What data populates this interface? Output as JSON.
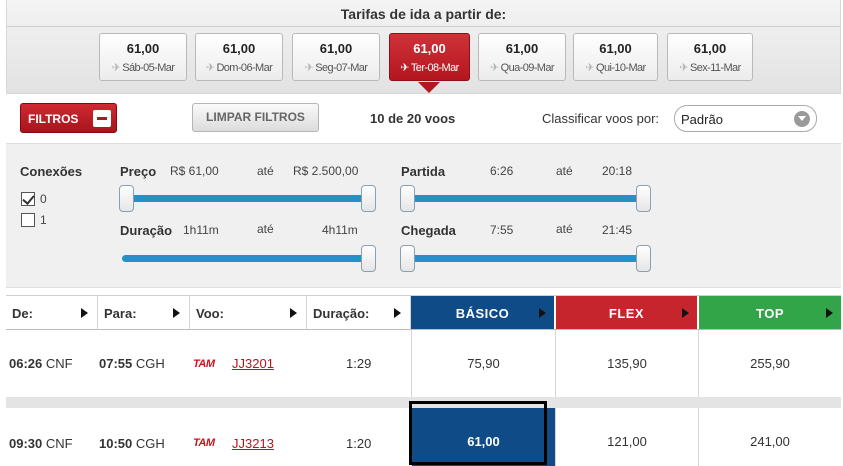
{
  "date_strip": {
    "title": "Tarifas de ida a partir de:",
    "tabs": [
      {
        "price": "61,00",
        "label": "Sáb-05-Mar",
        "selected": false
      },
      {
        "price": "61,00",
        "label": "Dom-06-Mar",
        "selected": false
      },
      {
        "price": "61,00",
        "label": "Seg-07-Mar",
        "selected": false
      },
      {
        "price": "61,00",
        "label": "Ter-08-Mar",
        "selected": true
      },
      {
        "price": "61,00",
        "label": "Qua-09-Mar",
        "selected": false
      },
      {
        "price": "61,00",
        "label": "Qui-10-Mar",
        "selected": false
      },
      {
        "price": "61,00",
        "label": "Sex-11-Mar",
        "selected": false
      }
    ]
  },
  "toolbar": {
    "filtros_label": "FILTROS",
    "limpar_label": "LIMPAR FILTROS",
    "count": "10 de 20 voos",
    "sort_label": "Classificar voos por:",
    "sort_value": "Padrão"
  },
  "filters": {
    "conexoes": {
      "label": "Conexões",
      "options": [
        {
          "label": "0",
          "checked": true
        },
        {
          "label": "1",
          "checked": false
        }
      ]
    },
    "preco": {
      "label": "Preço",
      "min": "R$ 61,00",
      "sep": "até",
      "max": "R$ 2.500,00"
    },
    "duracao": {
      "label": "Duração",
      "min": "1h11m",
      "sep": "até",
      "max": "4h11m"
    },
    "partida": {
      "label": "Partida",
      "min": "6:26",
      "sep": "até",
      "max": "20:18"
    },
    "chegada": {
      "label": "Chegada",
      "min": "7:55",
      "sep": "até",
      "max": "21:45"
    }
  },
  "table": {
    "headers": {
      "de": "De:",
      "para": "Para:",
      "voo": "Voo:",
      "duracao": "Duração:",
      "basico": "BÁSICO",
      "flex": "FLEX",
      "top": "TOP"
    },
    "airline_logo": "TAM",
    "rows": [
      {
        "dep_time": "06:26",
        "dep_airport": "CNF",
        "arr_time": "07:55",
        "arr_airport": "CGH",
        "flight": "JJ3201",
        "duration": "1:29",
        "basico": "75,90",
        "flex": "135,90",
        "top": "255,90",
        "selected": false
      },
      {
        "dep_time": "09:30",
        "dep_airport": "CNF",
        "arr_time": "10:50",
        "arr_airport": "CGH",
        "flight": "JJ3213",
        "duration": "1:20",
        "basico": "61,00",
        "flex": "121,00",
        "top": "241,00",
        "selected": true
      }
    ]
  },
  "colors": {
    "brand_red": "#b3161e",
    "basico_blue": "#0f4c87",
    "flex_red": "#c7252d",
    "top_green": "#31a547",
    "slider_blue": "#2790c4"
  }
}
